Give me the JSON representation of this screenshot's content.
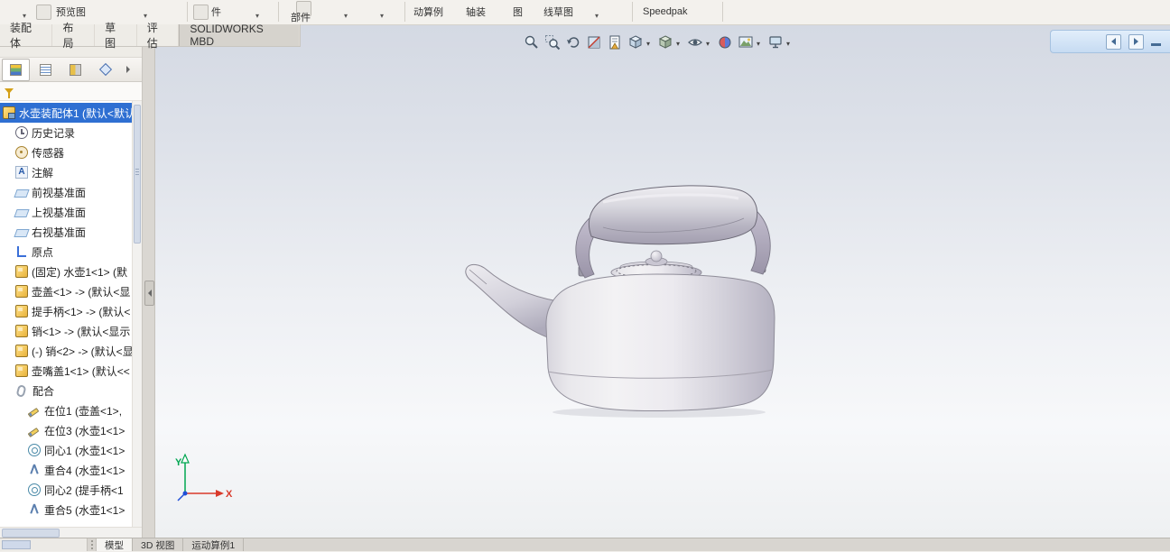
{
  "ribbon": {
    "fragments": [
      {
        "label": "预览图"
      },
      {
        "label": "件"
      },
      {
        "label": "部件"
      },
      {
        "label": "动算例"
      },
      {
        "label": "轴装"
      },
      {
        "label": "图"
      },
      {
        "label": "线草图"
      },
      {
        "label": "Speedpak"
      }
    ]
  },
  "command_tabs": {
    "items": [
      {
        "label": "装配体"
      },
      {
        "label": "布局"
      },
      {
        "label": "草图"
      },
      {
        "label": "评估"
      },
      {
        "label": "SOLIDWORKS MBD"
      }
    ]
  },
  "viewport_toolbar": {
    "buttons": [
      {
        "name": "zoom-fit",
        "caret": false
      },
      {
        "name": "zoom-area",
        "caret": false
      },
      {
        "name": "previous-view",
        "caret": false
      },
      {
        "name": "section-view",
        "caret": false
      },
      {
        "name": "dynamic-annotation",
        "caret": false
      },
      {
        "name": "view-orientation",
        "caret": true
      },
      {
        "name": "display-style",
        "caret": true
      },
      {
        "name": "hide-show-items",
        "caret": true
      },
      {
        "name": "edit-appearance",
        "caret": false
      },
      {
        "name": "apply-scene",
        "caret": true
      },
      {
        "name": "view-settings",
        "caret": true
      }
    ]
  },
  "icons": {
    "annotation_glyph": "A"
  },
  "tree": {
    "root_label": "水壶装配体1 (默认<默认",
    "items": [
      {
        "label": "历史记录"
      },
      {
        "label": "传感器"
      },
      {
        "label": "注解"
      },
      {
        "label": "前视基准面"
      },
      {
        "label": "上视基准面"
      },
      {
        "label": "右视基准面"
      },
      {
        "label": "原点"
      },
      {
        "label": "(固定) 水壶1<1> (默"
      },
      {
        "label": "壶盖<1> -> (默认<显"
      },
      {
        "label": "提手柄<1> -> (默认<"
      },
      {
        "label": "销<1> -> (默认<显示"
      },
      {
        "label": "(-) 销<2> -> (默认<显"
      },
      {
        "label": "壶嘴盖1<1> (默认<<"
      },
      {
        "label": "配合"
      },
      {
        "label": "在位1 (壶盖<1>,"
      },
      {
        "label": "在位3 (水壶1<1>"
      },
      {
        "label": "同心1 (水壶1<1>"
      },
      {
        "label": "重合4 (水壶1<1>"
      },
      {
        "label": "同心2 (提手柄<1"
      },
      {
        "label": "重合5 (水壶1<1>"
      }
    ]
  },
  "triad": {
    "x_label": "X",
    "y_label": "Y"
  },
  "status_bar": {
    "tabs": [
      {
        "label": "模型"
      },
      {
        "label": "3D 视图"
      },
      {
        "label": "运动算例1"
      }
    ]
  },
  "colors": {
    "selection_blue": "#2e6fd2",
    "viewport_gradient_top": "#d4d9e3",
    "viewport_gradient_bottom": "#f7f8fa",
    "taskpane_band": "#c6dbf2",
    "part_icon_yellow": "#eab332",
    "triad_x_red": "#d93a2b",
    "triad_y_green": "#00a651",
    "triad_z_blue": "#1f4fd8"
  }
}
